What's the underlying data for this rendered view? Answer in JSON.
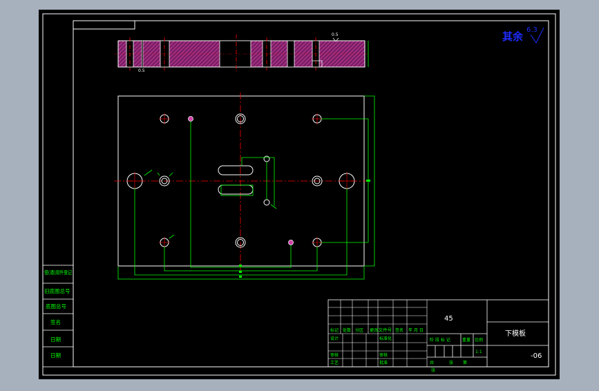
{
  "drawing": {
    "roughness_label": "其余",
    "roughness_value": "6.3",
    "section_note": "0.5",
    "section_note2": "0.5"
  },
  "left_strip": {
    "rows": [
      "借(通)用件登记",
      "旧底图总号",
      "底图总号",
      "签名",
      "日期",
      "日期"
    ]
  },
  "title_block": {
    "material": "45",
    "part_name": "下模板",
    "drawing_no": "-06",
    "revision_headers": [
      "标记",
      "处数",
      "分区",
      "更改文件号",
      "签名",
      "年 月 日"
    ],
    "design_label": "设计",
    "standardize_label": "标准化",
    "review_label": "审核",
    "craft_label": "工艺",
    "check_label": "审核",
    "approve_label": "批准",
    "stage_label": "阶 段 标 记",
    "weight_label": "重量",
    "scale_label": "比例",
    "scale_value": "1:1",
    "sheets_total_label": "共",
    "sheet_label": "张",
    "sheet_num_label": "第",
    "sheet_tail": "张"
  },
  "colors": {
    "background": "#a7b1bd",
    "canvas": "#000000",
    "lines": "#ffffff",
    "dimension": "#00ff00",
    "centerline": "#ff0000",
    "hatch": "#b0308a",
    "annotation": "#1e2cff"
  }
}
